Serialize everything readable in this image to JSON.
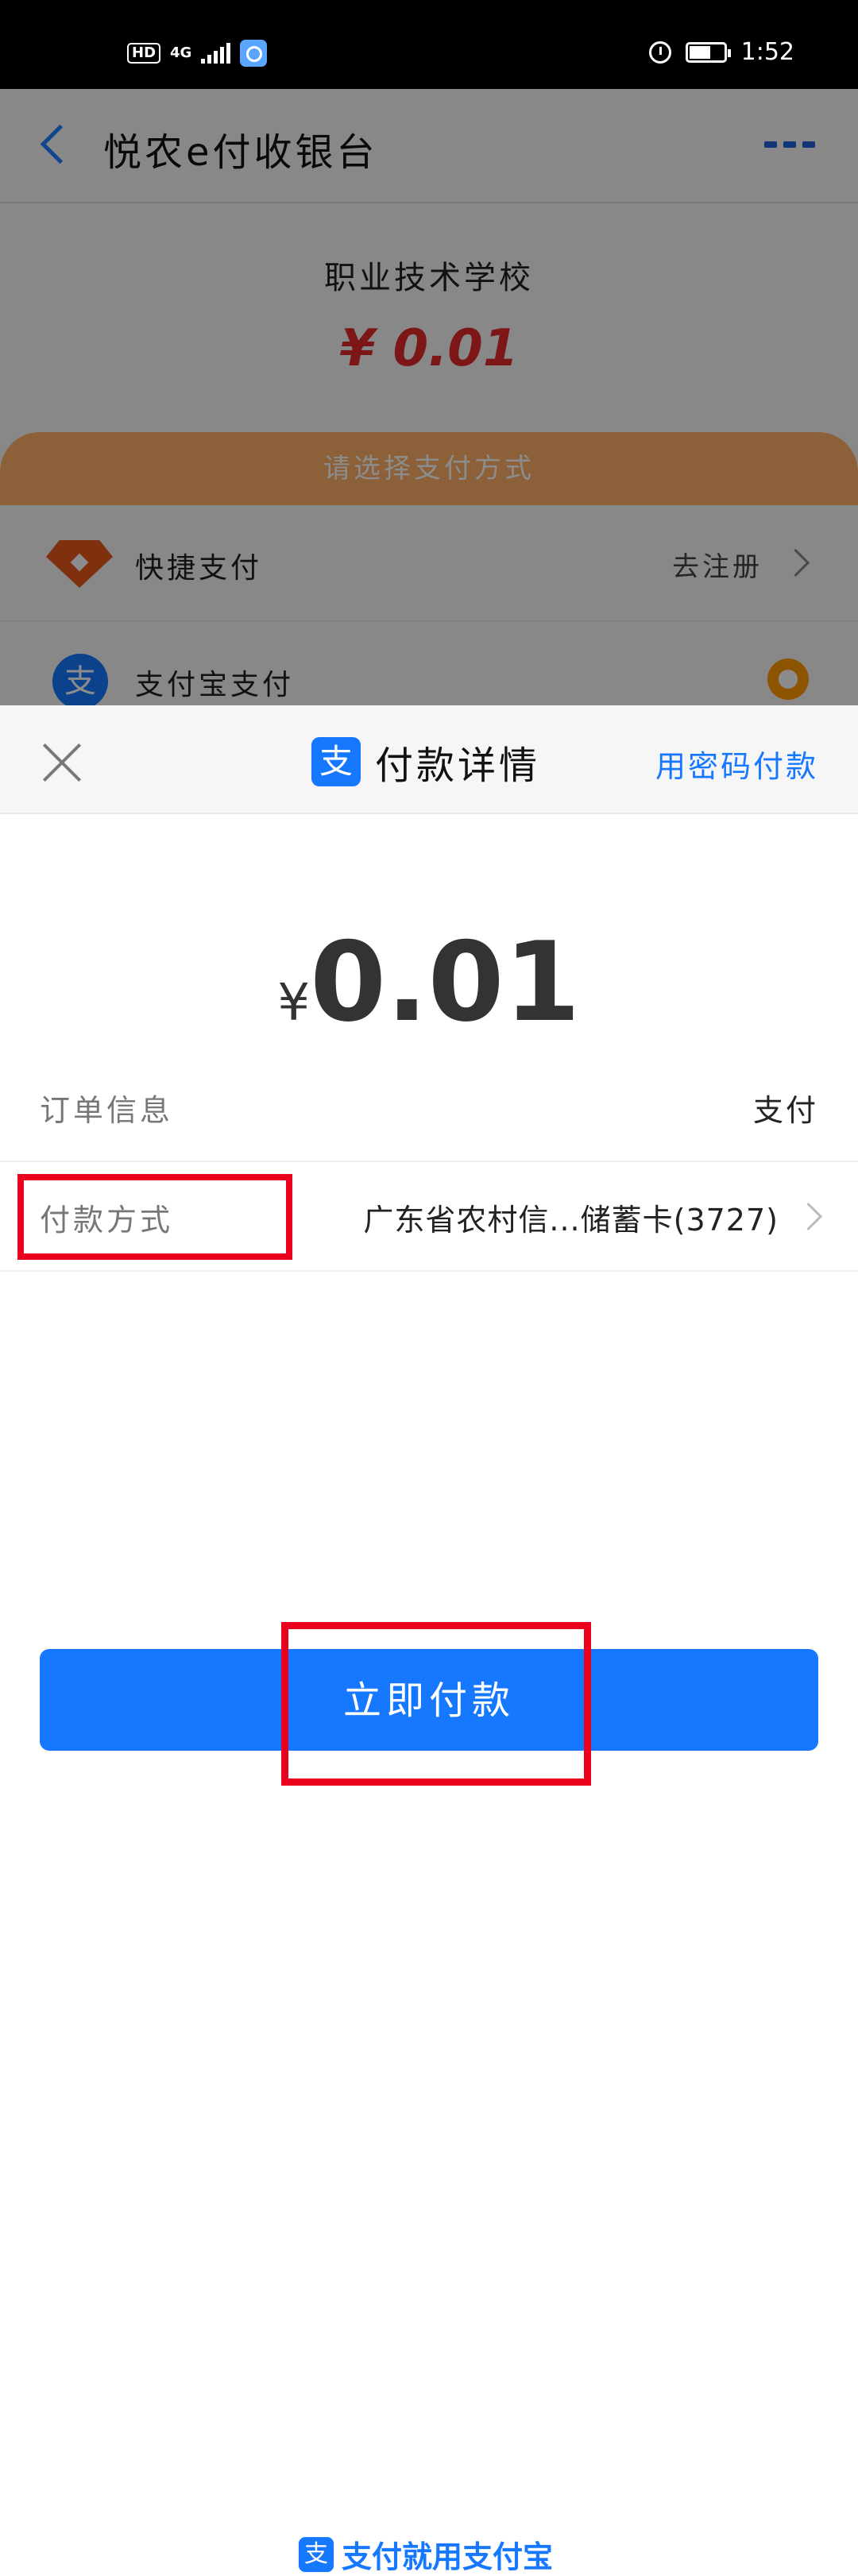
{
  "status_bar": {
    "hd": "HD",
    "network": "4G",
    "time": "1:52"
  },
  "background_page": {
    "title": "悦农e付收银台",
    "merchant": "职业技术学校",
    "amount": "¥ 0.01",
    "choose_method": "请选择支付方式",
    "methods": [
      {
        "label": "快捷支付",
        "action": "去注册"
      },
      {
        "label": "支付宝支付"
      }
    ]
  },
  "sheet": {
    "title": "付款详情",
    "logo_glyph": "支",
    "password_pay": "用密码付款",
    "currency": "¥",
    "amount": "0.01",
    "order_info": {
      "label": "订单信息",
      "value": "支付"
    },
    "payment_method": {
      "label": "付款方式",
      "value": "广东省农村信...储蓄卡(3727)"
    },
    "pay_button": "立即付款",
    "footer": "支付就用支付宝"
  },
  "colors": {
    "accent": "#1677ff",
    "highlight": "#e8001c",
    "amount_red": "#e32b2b"
  }
}
